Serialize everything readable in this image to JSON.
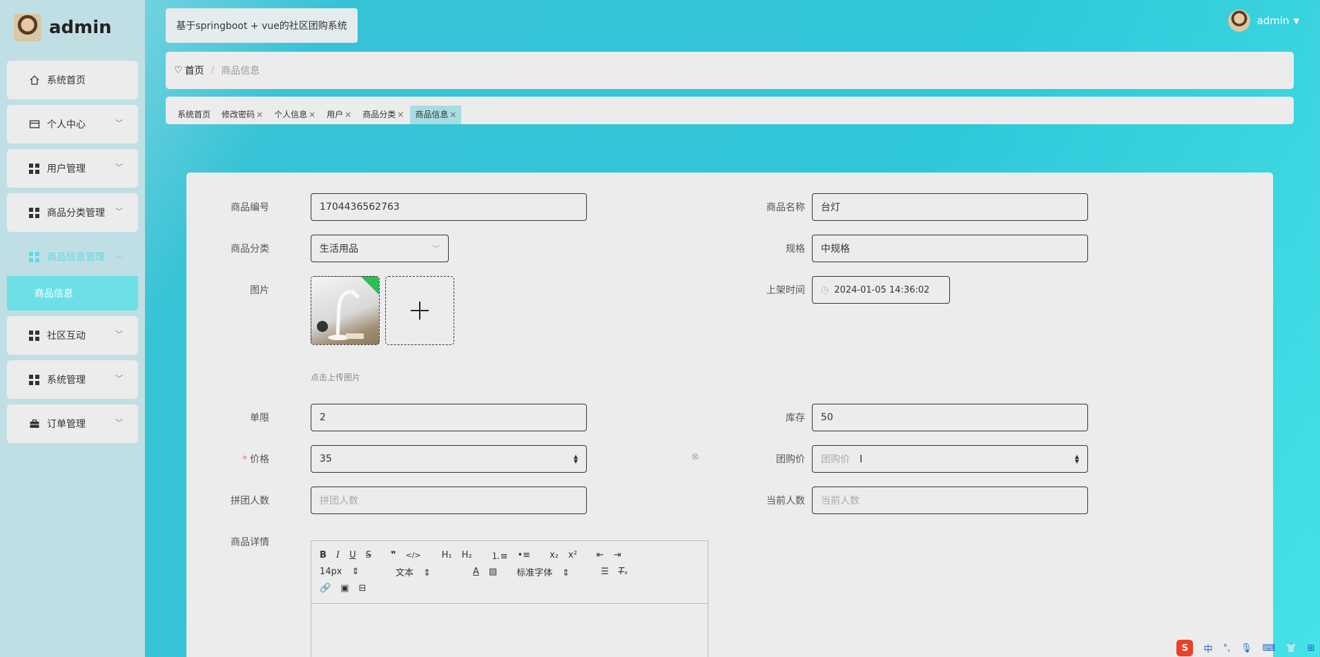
{
  "brand": {
    "name": "admin"
  },
  "sidebar": {
    "items": [
      {
        "label": "系统首页"
      },
      {
        "label": "个人中心"
      },
      {
        "label": "用户管理"
      },
      {
        "label": "商品分类管理"
      },
      {
        "label": "商品信息管理"
      },
      {
        "label": "社区互动"
      },
      {
        "label": "系统管理"
      },
      {
        "label": "订单管理"
      }
    ],
    "sub_item": "商品信息"
  },
  "header": {
    "title": "基于springboot + vue的社区团购系统",
    "user": "admin"
  },
  "breadcrumb": {
    "home": "首页",
    "sep": "/",
    "current": "商品信息"
  },
  "tabs": [
    {
      "label": "系统首页"
    },
    {
      "label": "修改密码",
      "close": "×"
    },
    {
      "label": "个人信息",
      "close": "×"
    },
    {
      "label": "用户",
      "close": "×"
    },
    {
      "label": "商品分类",
      "close": "×"
    },
    {
      "label": "商品信息",
      "close": "×"
    }
  ],
  "form": {
    "code_label": "商品编号",
    "code_value": "1704436562763",
    "name_label": "商品名称",
    "name_value": "台灯",
    "category_label": "商品分类",
    "category_value": "生活用品",
    "spec_label": "规格",
    "spec_value": "中规格",
    "image_label": "图片",
    "upload_hint": "点击上传图片",
    "shelf_time_label": "上架时间",
    "shelf_time_value": "2024-01-05 14:36:02",
    "limit_label": "单限",
    "limit_value": "2",
    "stock_label": "库存",
    "stock_value": "50",
    "price_label": "价格",
    "price_required": "*",
    "price_value": "35",
    "group_price_label": "团购价",
    "group_price_placeholder": "团购价",
    "group_size_label": "拼团人数",
    "group_size_placeholder": "拼团人数",
    "current_count_label": "当前人数",
    "current_count_placeholder": "当前人数",
    "detail_label": "商品详情"
  },
  "editor": {
    "font_size": "14px",
    "text_type": "文本",
    "font_family": "标准字体"
  },
  "tray": {
    "ime": "S",
    "lang": "中"
  },
  "colors": {
    "accent": "#5fd9e4",
    "active_sub": "#6ce0e6",
    "required": "#f56c6c"
  }
}
